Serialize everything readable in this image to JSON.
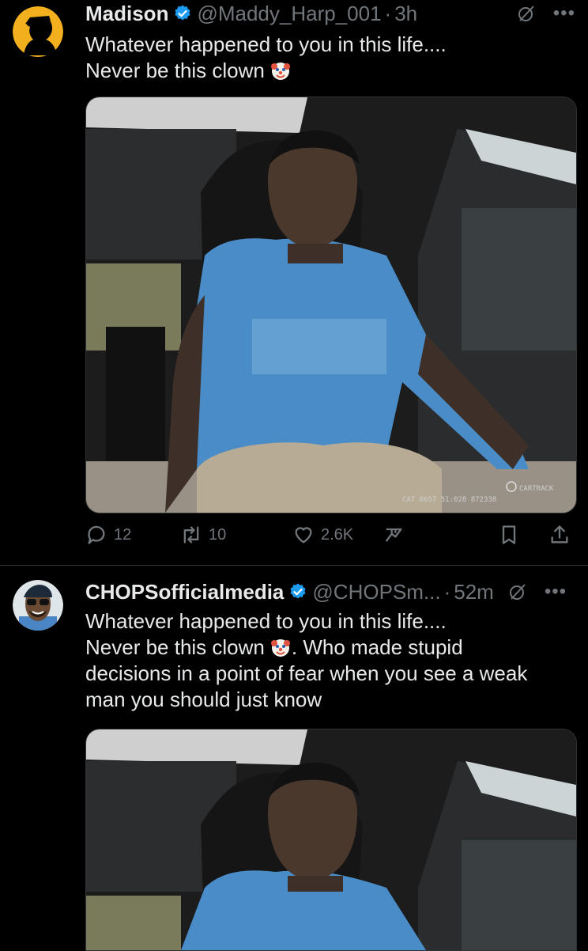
{
  "tweets": [
    {
      "name": "Madison",
      "handle": "@Maddy_Harp_001",
      "separator": "·",
      "time": "3h",
      "text_lines": [
        "Whatever happened to you in this life....",
        "Never be this clown"
      ],
      "actions": {
        "replies": "12",
        "retweets": "10",
        "likes": "2.6K"
      },
      "watermark": {
        "brand": "CARTRACK",
        "code": "CAT 8657 51:028 872338"
      }
    },
    {
      "name": "CHOPSofficialmedia",
      "handle": "@CHOPSm...",
      "separator": "·",
      "time": "52m",
      "text_lines": [
        "Whatever happened to you in this life....",
        "Never be this clown",
        ". Who made stupid",
        "decisions in a point of fear when you see a weak",
        "man you should just know"
      ]
    }
  ],
  "icons": {
    "verified": "verified-badge-icon",
    "clown": "clown-face-emoji",
    "grok": "grok-icon",
    "more": "more-icon",
    "reply": "reply-icon",
    "retweet": "retweet-icon",
    "like": "heart-icon",
    "views": "views-icon",
    "bookmark": "bookmark-icon",
    "share": "share-icon"
  },
  "colors": {
    "background": "#000000",
    "text": "#e7e9ea",
    "secondary": "#71767b",
    "verified": "#1d9bf0",
    "divider": "#2f3336"
  }
}
